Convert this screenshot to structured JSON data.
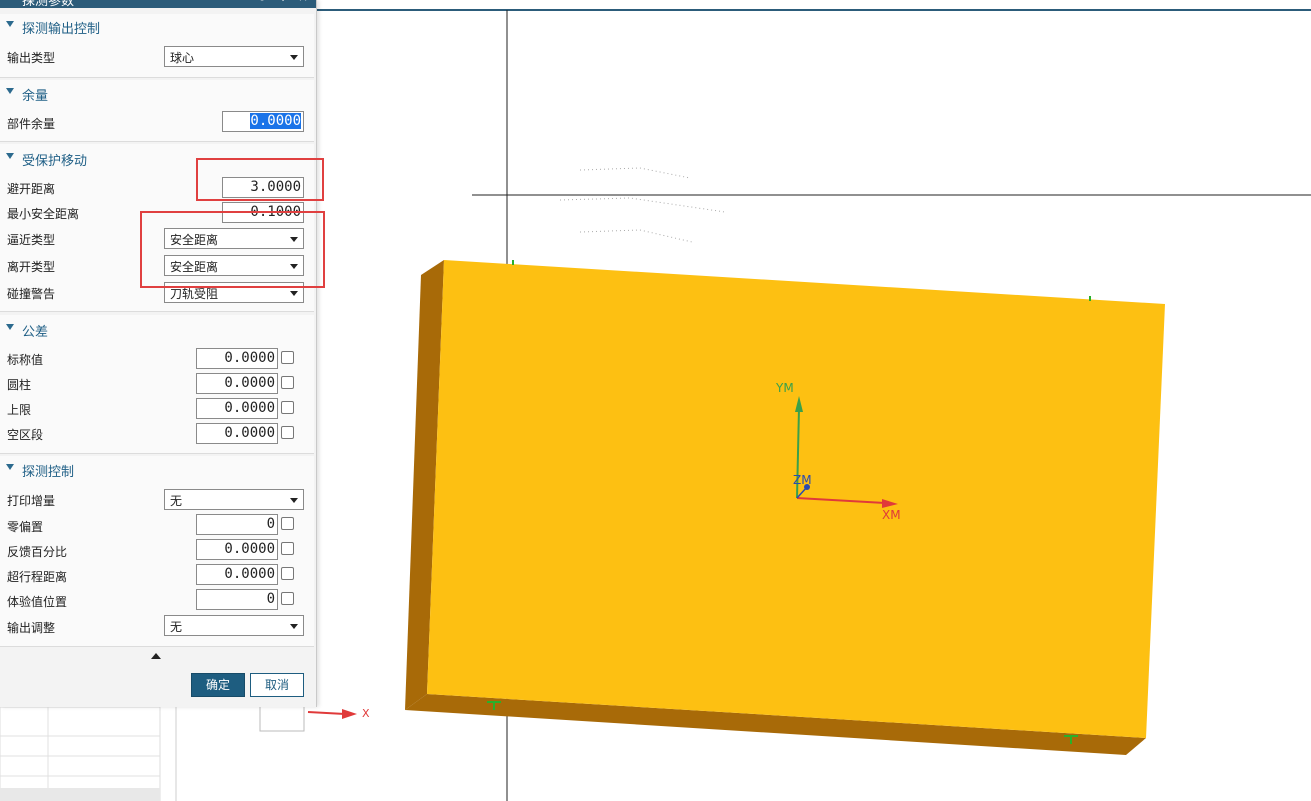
{
  "dialog": {
    "title": "探测参数",
    "title_controls": [
      "⟳",
      "+",
      "×"
    ],
    "sections": {
      "output": {
        "title": "探测输出控制",
        "output_type_label": "输出类型",
        "output_type_value": "球心"
      },
      "stock": {
        "title": "余量",
        "part_stock_label": "部件余量",
        "part_stock_value": "0.0000"
      },
      "protected": {
        "title": "受保护移动",
        "clearance_label": "避开距离",
        "clearance_value": "3.0000",
        "min_safe_label": "最小安全距离",
        "min_safe_value": "0.1000",
        "approach_label": "逼近类型",
        "approach_value": "安全距离",
        "retract_label": "离开类型",
        "retract_value": "安全距离",
        "collision_label": "碰撞警告",
        "collision_value": "刀轨受阻"
      },
      "tolerance": {
        "title": "公差",
        "rows": [
          {
            "label": "标称值",
            "value": "0.0000"
          },
          {
            "label": "圆柱",
            "value": "0.0000"
          },
          {
            "label": "上限",
            "value": "0.0000"
          },
          {
            "label": "空区段",
            "value": "0.0000"
          }
        ]
      },
      "probe_control": {
        "title": "探测控制",
        "print_inc_label": "打印增量",
        "print_inc_value": "无",
        "zero_offset_label": "零偏置",
        "zero_offset_value": "0",
        "feedback_label": "反馈百分比",
        "feedback_value": "0.0000",
        "overtravel_label": "超行程距离",
        "overtravel_value": "0.0000",
        "test_pos_label": "体验值位置",
        "test_pos_value": "0",
        "output_adjust_label": "输出调整",
        "output_adjust_value": "无"
      }
    },
    "ok_label": "确定",
    "cancel_label": "取消"
  },
  "viewport": {
    "axis_labels": {
      "ym": "YM",
      "xm": "XM",
      "zm": "ZM",
      "x": "X"
    },
    "colors": {
      "block_top": "#fdc012",
      "block_side": "#a86a08",
      "axis_x": "#e03a3a",
      "axis_y": "#3aa04a",
      "axis_z": "#2a4ab0",
      "highlight": "#e04040"
    }
  }
}
